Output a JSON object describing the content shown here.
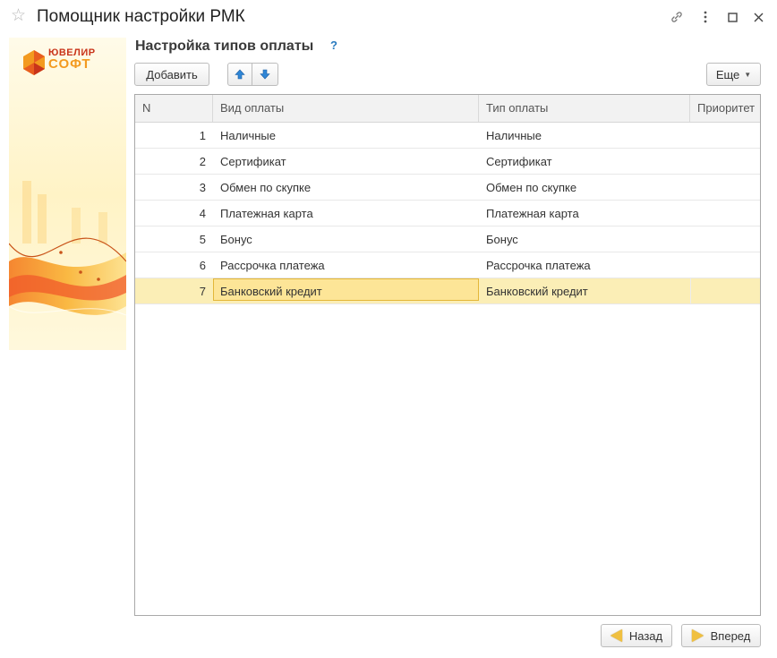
{
  "window": {
    "title": "Помощник настройки РМК"
  },
  "banner": {
    "logo_line1": "ЮВЕЛИР",
    "logo_line2": "СОФТ"
  },
  "section": {
    "title": "Настройка типов оплаты",
    "help": "?"
  },
  "toolbar": {
    "add_label": "Добавить",
    "more_label": "Еще"
  },
  "table": {
    "columns": [
      "N",
      "Вид оплаты",
      "Тип оплаты",
      "Приоритет"
    ],
    "rows": [
      {
        "n": "1",
        "vid": "Наличные",
        "tip": "Наличные",
        "pri": ""
      },
      {
        "n": "2",
        "vid": "Сертификат",
        "tip": "Сертификат",
        "pri": ""
      },
      {
        "n": "3",
        "vid": "Обмен по скупке",
        "tip": "Обмен по скупке",
        "pri": ""
      },
      {
        "n": "4",
        "vid": "Платежная карта",
        "tip": "Платежная карта",
        "pri": ""
      },
      {
        "n": "5",
        "vid": "Бонус",
        "tip": "Бонус",
        "pri": ""
      },
      {
        "n": "6",
        "vid": "Рассрочка платежа",
        "tip": "Рассрочка платежа",
        "pri": ""
      },
      {
        "n": "7",
        "vid": "Банковский кредит",
        "tip": "Банковский кредит",
        "pri": ""
      }
    ],
    "selected_row": 7
  },
  "footer": {
    "back_label": "Назад",
    "next_label": "Вперед"
  },
  "colors": {
    "accent_blue": "#2a7bbf",
    "selection": "#fbeeb6",
    "selection_border": "#e3b739",
    "brand_orange": "#f39a1f"
  }
}
